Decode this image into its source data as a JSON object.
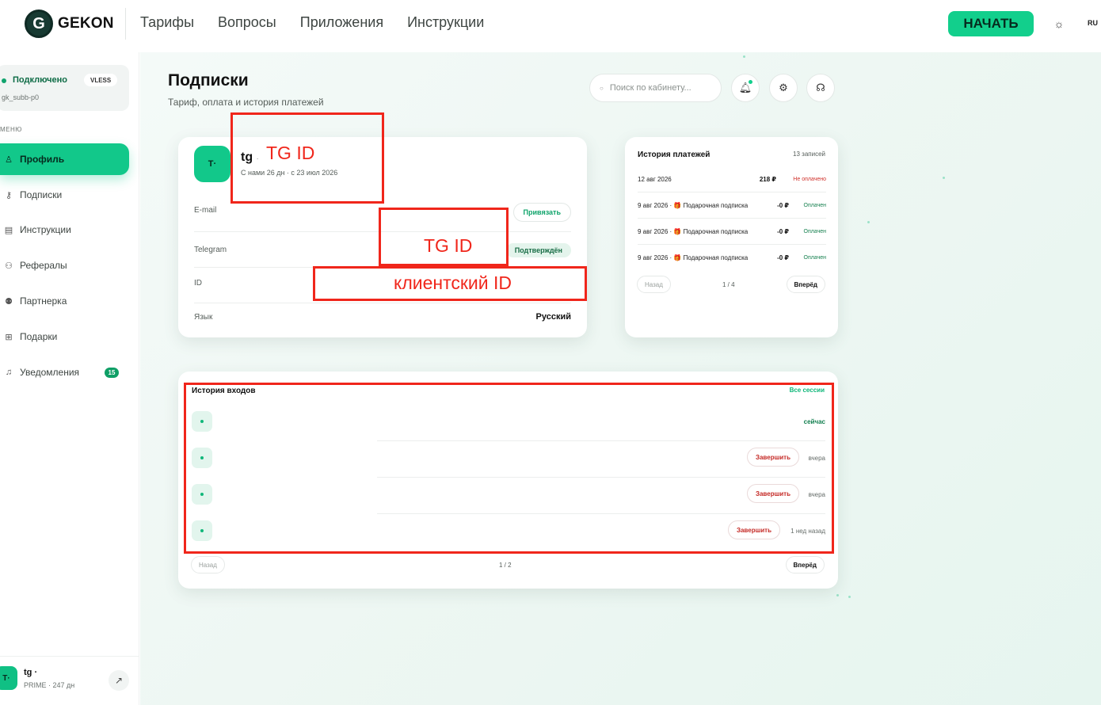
{
  "header": {
    "logo_mark": "G",
    "logo_text": "GEKON",
    "nav": [
      "Тарифы",
      "Вопросы",
      "Приложения",
      "Инструкции"
    ],
    "start_label": "НАЧАТЬ",
    "theme_icon": "sun-icon",
    "lang": "RU"
  },
  "sidebar": {
    "status": "Подключено",
    "protocol": "VLESS",
    "sub_id": "gk_subb-p0",
    "menu_label": "МЕНЮ",
    "items": [
      {
        "label": "Профиль",
        "icon": "user-icon",
        "active": true
      },
      {
        "label": "Подписки",
        "icon": "key-icon"
      },
      {
        "label": "Инструкции",
        "icon": "document-icon"
      },
      {
        "label": "Рефералы",
        "icon": "users-icon"
      },
      {
        "label": "Партнерка",
        "icon": "group-icon"
      },
      {
        "label": "Подарки",
        "icon": "gift-icon"
      },
      {
        "label": "Уведомления",
        "icon": "bell-icon",
        "badge": "15"
      }
    ],
    "user": {
      "avatar": "T·",
      "name": "tg ·",
      "plan": "PRIME · 247 дн"
    }
  },
  "main": {
    "title": "Подписки",
    "subtitle": "Тариф, оплата и история платежей",
    "search_placeholder": "Поиск по кабинету...",
    "profile": {
      "avatar": "T·",
      "name": "tg",
      "name_suffix": "·",
      "since": "С нами 26 дн · с 23 июл 2026",
      "rows": {
        "email": {
          "key": "E-mail",
          "action": "Привязать"
        },
        "telegram": {
          "key": "Telegram",
          "status": "Подтверждён"
        },
        "id": {
          "key": "ID"
        },
        "lang": {
          "key": "Язык",
          "value": "Русский"
        }
      }
    },
    "payments": {
      "title": "История платежей",
      "count": "13 записей",
      "rows": [
        {
          "date": "12 авг 2026",
          "amount": "218 ₽",
          "status": "Не оплачено",
          "paid": false
        },
        {
          "date": "9 авг 2026 · 🎁 Подарочная подписка",
          "amount": "-0 ₽",
          "status": "Оплачен",
          "paid": true
        },
        {
          "date": "9 авг 2026 · 🎁 Подарочная подписка",
          "amount": "-0 ₽",
          "status": "Оплачен",
          "paid": true
        },
        {
          "date": "9 авг 2026 · 🎁 Подарочная подписка",
          "amount": "-0 ₽",
          "status": "Оплачен",
          "paid": true
        }
      ],
      "prev": "Назад",
      "page": "1 / 4",
      "next": "Вперёд"
    },
    "sessions": {
      "title": "История входов",
      "all": "Все сессии",
      "rows": [
        {
          "time": "сейчас",
          "current": true
        },
        {
          "time": "вчера",
          "end": "Завершить"
        },
        {
          "time": "вчера",
          "end": "Завершить"
        },
        {
          "time": "1 нед назад",
          "end": "Завершить"
        }
      ],
      "prev": "Назад",
      "page": "1 / 2",
      "next": "Вперёд"
    }
  },
  "annotations": {
    "tg_id_1": "TG ID",
    "tg_id_2": "TG ID",
    "client_id": "клиентский ID",
    "color": "#f0261b"
  },
  "colors": {
    "accent": "#12c88a",
    "brand_dark": "#173a32",
    "paid": "#16804f",
    "unpaid": "#d0302a"
  }
}
